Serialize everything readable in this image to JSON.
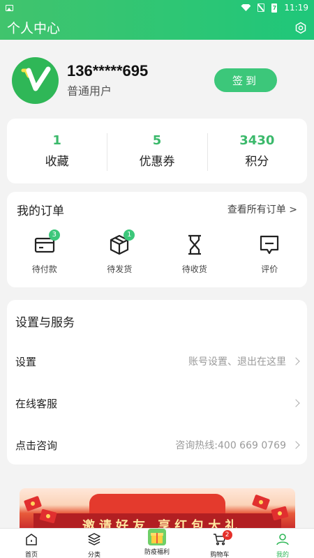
{
  "statusbar": {
    "time": "11:19",
    "battery": "7"
  },
  "header": {
    "title": "个人中心"
  },
  "profile": {
    "phone": "136*****695",
    "level": "普通用户",
    "signin_label": "签到"
  },
  "stats": [
    {
      "value": "1",
      "label": "收藏"
    },
    {
      "value": "5",
      "label": "优惠券"
    },
    {
      "value": "3430",
      "label": "积分"
    }
  ],
  "orders": {
    "title": "我的订单",
    "view_all": "查看所有订单 >",
    "items": [
      {
        "label": "待付款",
        "badge": "3",
        "icon": "wallet-icon"
      },
      {
        "label": "待发货",
        "badge": "1",
        "icon": "box-icon"
      },
      {
        "label": "待收货",
        "badge": "",
        "icon": "hourglass-icon"
      },
      {
        "label": "评价",
        "badge": "",
        "icon": "comment-icon"
      }
    ]
  },
  "settings": {
    "title": "设置与服务",
    "rows": [
      {
        "label": "设置",
        "value": "账号设置、退出在这里"
      },
      {
        "label": "在线客服",
        "value": ""
      },
      {
        "label": "点击咨询",
        "value": "咨询热线:400 669 0769"
      }
    ]
  },
  "banner": {
    "text": "邀请好友 享红包大礼"
  },
  "tabs": [
    {
      "label": "首页",
      "icon": "home-icon",
      "badge": ""
    },
    {
      "label": "分类",
      "icon": "layers-icon",
      "badge": ""
    },
    {
      "label": "防疫福利",
      "icon": "gift-icon",
      "badge": ""
    },
    {
      "label": "购物车",
      "icon": "cart-icon",
      "badge": "2"
    },
    {
      "label": "我的",
      "icon": "user-icon",
      "badge": ""
    }
  ],
  "colors": {
    "brand": "#3cc77a",
    "badge_red": "#e5302b"
  }
}
